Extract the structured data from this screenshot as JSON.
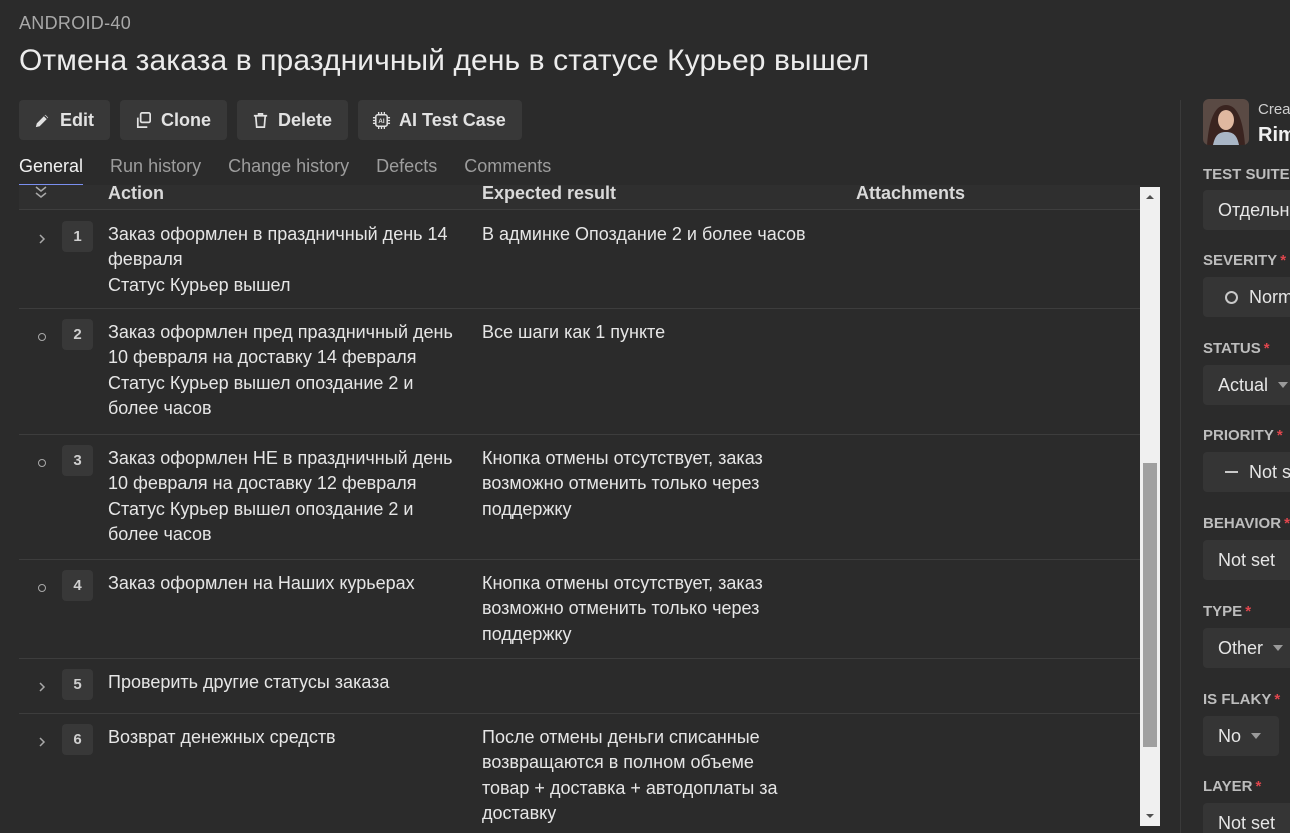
{
  "case_key": "ANDROID-40",
  "title": "Отмена заказа в праздничный день в статусе Курьер вышел",
  "toolbar": {
    "edit": "Edit",
    "clone": "Clone",
    "delete": "Delete",
    "ai": "AI Test Case"
  },
  "tabs": [
    "General",
    "Run history",
    "Change history",
    "Defects",
    "Comments"
  ],
  "active_tab": "General",
  "steps_table": {
    "headers": {
      "action": "Action",
      "expected": "Expected result",
      "attachments": "Attachments"
    },
    "rows": [
      {
        "num": "1",
        "control": "chevron",
        "action": [
          "Заказ оформлен в праздничный день 14",
          "февраля",
          "Статус Курьер вышел"
        ],
        "expected": [
          "В админке Опоздание 2 и более часов"
        ]
      },
      {
        "num": "2",
        "control": "dot",
        "action": [
          "Заказ оформлен пред праздничный день",
          "10 февраля на доставку 14 февраля",
          "Статус Курьер вышел опоздание 2 и",
          "более часов"
        ],
        "expected": [
          "Все шаги как 1 пункте"
        ]
      },
      {
        "num": "3",
        "control": "dot",
        "action": [
          "Заказ оформлен НЕ в праздничный день",
          "10 февраля на доставку 12 февраля",
          "Статус Курьер вышел опоздание 2 и",
          "более часов"
        ],
        "expected": [
          "Кнопка отмены отсутствует, заказ",
          "возможно отменить только через",
          "поддержку"
        ]
      },
      {
        "num": "4",
        "control": "dot",
        "action": [
          "Заказ оформлен на Наших курьерах"
        ],
        "expected": [
          "Кнопка отмены отсутствует, заказ",
          "возможно отменить только через",
          "поддержку"
        ]
      },
      {
        "num": "5",
        "control": "chevron",
        "action": [
          "Проверить другие статусы заказа"
        ],
        "expected": []
      },
      {
        "num": "6",
        "control": "chevron",
        "action": [
          "Возврат денежных средств"
        ],
        "expected": [
          "После отмены деньги списанные",
          "возвращаются в полном объеме",
          "товар + доставка + автодоплаты за",
          "доставку"
        ]
      }
    ]
  },
  "sidebar": {
    "creator_label": "Crea",
    "creator_name": "Rim",
    "fields": {
      "test_suite": {
        "label": "TEST SUITE",
        "value": "Отдельн"
      },
      "severity": {
        "label": "SEVERITY",
        "value": "Norm"
      },
      "status": {
        "label": "STATUS",
        "value": "Actual"
      },
      "priority": {
        "label": "PRIORITY",
        "value": "Not s"
      },
      "behavior": {
        "label": "BEHAVIOR",
        "value": "Not set"
      },
      "type": {
        "label": "TYPE",
        "value": "Other"
      },
      "is_flaky": {
        "label": "IS FLAKY",
        "value": "No"
      },
      "layer": {
        "label": "LAYER",
        "value": "Not set"
      }
    },
    "required_mark": "*"
  },
  "colors": {
    "background": "#2b2b2b",
    "button_bg": "#383838",
    "tab_underline": "#7a8ff0",
    "required": "#e0464d"
  }
}
